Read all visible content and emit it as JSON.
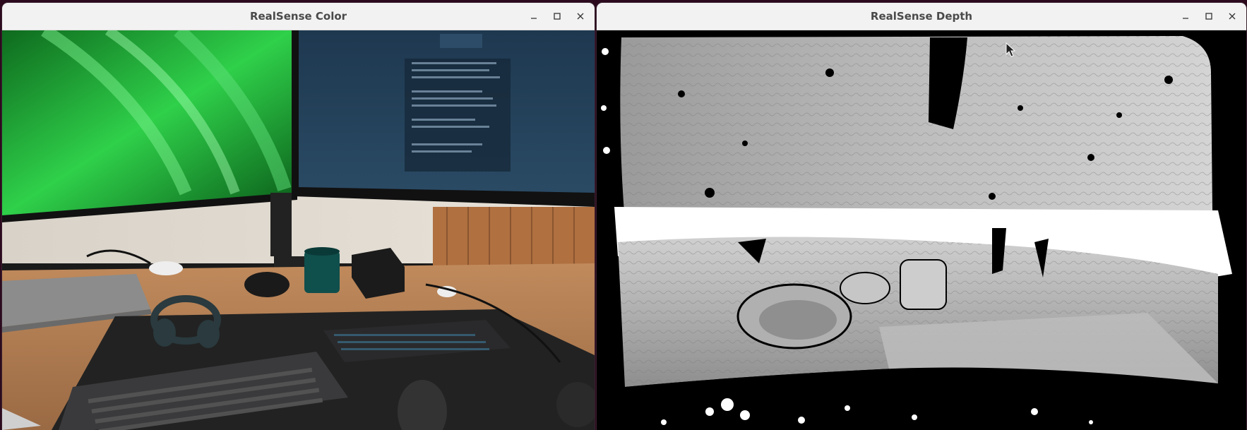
{
  "windows": {
    "color": {
      "title": "RealSense Color",
      "icons": [
        "minimize-icon",
        "maximize-icon",
        "close-icon"
      ]
    },
    "depth": {
      "title": "RealSense Depth",
      "icons": [
        "minimize-icon",
        "maximize-icon",
        "close-icon"
      ]
    }
  },
  "colors": {
    "desktop_bg": "#2c0a1e",
    "titlebar_bg": "#f2f2f2",
    "title_text": "#4a4a4a",
    "depth_black": "#000000",
    "depth_white": "#ffffff",
    "desk_wood": "#b9845a",
    "wallpaper_green": "#1ea83a"
  }
}
